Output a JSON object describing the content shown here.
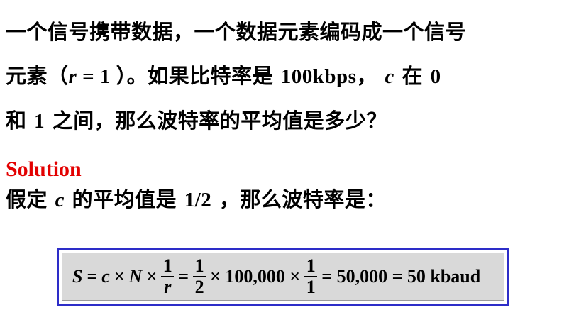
{
  "problem": {
    "line1": "一个信号携带数据，一个数据元素编码成一个信号",
    "line2_prefix": "元素（",
    "line2_var_r": "r",
    "line2_eq": " = 1 ",
    "line2_mid": "）。如果比特率是",
    "line2_bitrate": "100kbps",
    "line2_comma": "，",
    "line2_var_c": "c",
    "line2_at": "在",
    "line2_zero": "0",
    "line3_and": "和",
    "line3_one": "1",
    "line3_rest": "之间，那么波特率的平均值是多少？"
  },
  "solution": {
    "heading": "Solution",
    "text_prefix": "假定",
    "text_var": "c",
    "text_mid": "的平均值是",
    "text_value": "1/2",
    "text_suffix": "，那么波特率是："
  },
  "formula": {
    "S": "S",
    "eq1": "=",
    "c": "c",
    "times1": "×",
    "N": "N",
    "times2": "×",
    "frac1_num": "1",
    "frac1_den": "r",
    "eq2": "=",
    "frac2_num": "1",
    "frac2_den": "2",
    "times3": "× 100,000 ×",
    "frac3_num": "1",
    "frac3_den": "1",
    "result": "= 50,000 = 50 kbaud"
  },
  "colors": {
    "heading": "#e30000",
    "box_border": "#2d2dc8",
    "box_fill": "#d9d9d9"
  }
}
